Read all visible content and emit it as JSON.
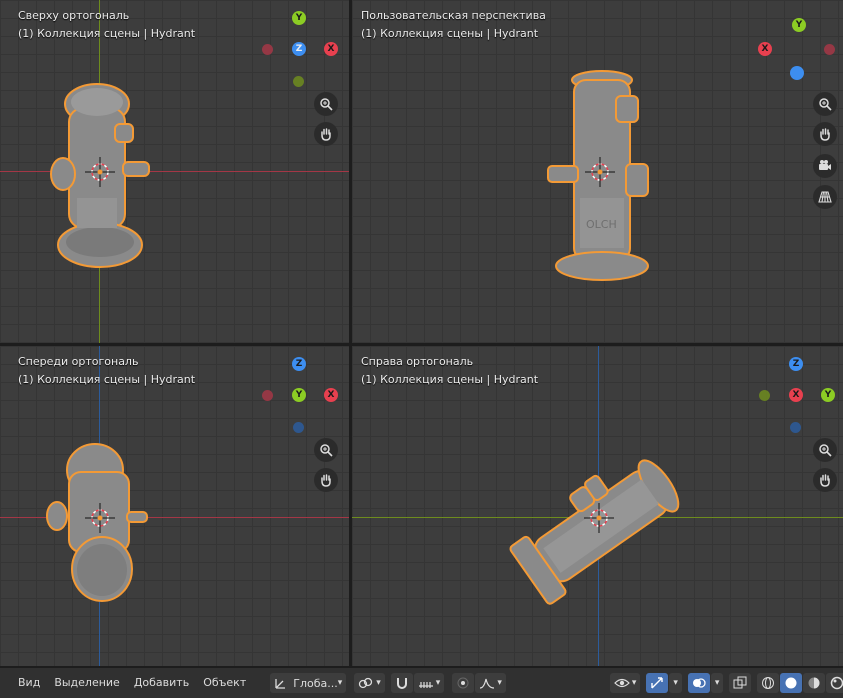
{
  "viewports": [
    {
      "title": "Сверху ортогональ",
      "subtitle": "(1) Коллекция сцены | Hydrant"
    },
    {
      "title": "Пользовательская перспектива",
      "subtitle": "(1) Коллекция сцены | Hydrant"
    },
    {
      "title": "Спереди ортогональ",
      "subtitle": "(1) Коллекция сцены | Hydrant"
    },
    {
      "title": "Справа ортогональ",
      "subtitle": "(1) Коллекция сцены | Hydrant"
    }
  ],
  "gizmo_labels": {
    "x": "X",
    "y": "Y",
    "z": "Z"
  },
  "colors": {
    "x": "#e8404f",
    "y": "#8ccc24",
    "z": "#3d8ef0",
    "neg_x": "#a43746",
    "neg_y": "#6e8c1e",
    "neg_z": "#2c5c9c",
    "selection": "#f39a36",
    "viewport_bg": "#3d3d3d",
    "grid_line": "#353535",
    "active_button": "#4772b3"
  },
  "icons": {
    "zoom": "magnifier-plus-icon",
    "pan": "hand-icon",
    "camera": "camera-icon",
    "perspective": "grid-perspective-icon",
    "cursor": "3d-cursor-icon"
  },
  "bottombar": {
    "menu": [
      "Вид",
      "Выделение",
      "Добавить",
      "Объект"
    ],
    "transform_orientation": "Глоба..."
  }
}
